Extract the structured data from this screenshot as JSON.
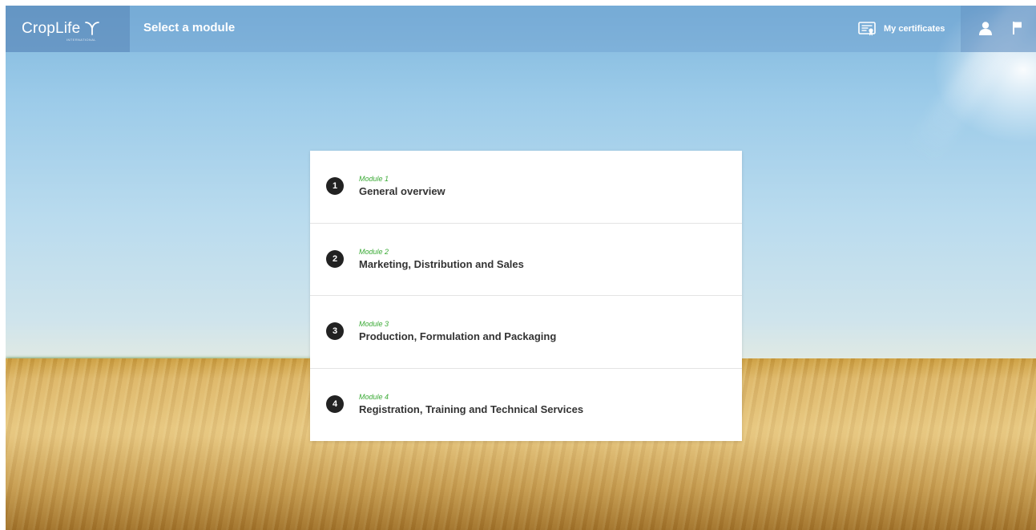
{
  "brand": {
    "name": "CropLife",
    "tagline": "INTERNATIONAL",
    "logo_icon": "sprout-icon"
  },
  "header": {
    "title": "Select a module"
  },
  "toolbar": {
    "certificates_label": "My certificates",
    "certificates_icon": "certificate-icon",
    "user_icon": "user-icon",
    "flag_icon": "flag-icon"
  },
  "modules": [
    {
      "number": "1",
      "kicker": "Module 1",
      "title": "General overview"
    },
    {
      "number": "2",
      "kicker": "Module 2",
      "title": "Marketing, Distribution and Sales"
    },
    {
      "number": "3",
      "kicker": "Module 3",
      "title": "Production, Formulation and Packaging"
    },
    {
      "number": "4",
      "kicker": "Module 4",
      "title": "Registration, Training and Technical Services"
    }
  ],
  "colors": {
    "accent": "#3aaa35",
    "badge": "#222222",
    "title_text": "#333333"
  }
}
